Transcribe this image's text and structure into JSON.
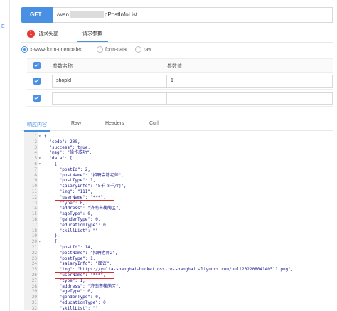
{
  "left_edge": {
    "tick": "E"
  },
  "request": {
    "method": "GET",
    "url_prefix": "/wan",
    "url_suffix": "pPostInfoList"
  },
  "req_tabs": {
    "badge": "1",
    "headers_label": "请求头部",
    "params_label": "请求参数"
  },
  "body_types": [
    {
      "label": "x-www-form-urlencoded",
      "selected": true
    },
    {
      "label": "form-data",
      "selected": false
    },
    {
      "label": "raw",
      "selected": false
    }
  ],
  "params_table": {
    "col_name": "参数名称",
    "col_value": "参数值",
    "rows": [
      {
        "name": "shopId",
        "value": "1"
      },
      {
        "name": "",
        "value": ""
      }
    ]
  },
  "response_tabs": [
    "响应内容",
    "Raw",
    "Headers",
    "Curl"
  ],
  "code_lines": [
    {
      "n": "1",
      "fold": "▾",
      "text": "{"
    },
    {
      "n": "2",
      "fold": "",
      "text": "  \"code\": 200,"
    },
    {
      "n": "3",
      "fold": "",
      "text": "  \"success\": true,"
    },
    {
      "n": "4",
      "fold": "",
      "text": "  \"msg\": \"操作成功\","
    },
    {
      "n": "5",
      "fold": "▾",
      "text": "  \"data\": ["
    },
    {
      "n": "6",
      "fold": "▾",
      "text": "    {"
    },
    {
      "n": "7",
      "fold": "",
      "text": "      \"postId\": 2,"
    },
    {
      "n": "8",
      "fold": "",
      "text": "      \"postName\": \"招聘会籍老师\","
    },
    {
      "n": "9",
      "fold": "",
      "text": "      \"postType\": 1,"
    },
    {
      "n": "10",
      "fold": "",
      "text": "      \"salaryInfo\": \"5千-8千/月\","
    },
    {
      "n": "11",
      "fold": "",
      "text": "      \"img\": \"111\","
    },
    {
      "n": "12",
      "fold": "",
      "text": "      \"userName\": \"***\","
    },
    {
      "n": "13",
      "fold": "",
      "text": "      \"type\": 0,"
    },
    {
      "n": "14",
      "fold": "",
      "text": "      \"address\": \"济南市槐荫区\","
    },
    {
      "n": "15",
      "fold": "",
      "text": "      \"ageType\": 0,"
    },
    {
      "n": "16",
      "fold": "",
      "text": "      \"genderType\": 0,"
    },
    {
      "n": "17",
      "fold": "",
      "text": "      \"educationType\": 0,"
    },
    {
      "n": "18",
      "fold": "",
      "text": "      \"skillList\": \"\""
    },
    {
      "n": "19",
      "fold": "",
      "text": "    },"
    },
    {
      "n": "20",
      "fold": "▾",
      "text": "    {"
    },
    {
      "n": "21",
      "fold": "",
      "text": "      \"postId\": 14,"
    },
    {
      "n": "22",
      "fold": "",
      "text": "      \"postName\": \"招聘老师2\","
    },
    {
      "n": "23",
      "fold": "",
      "text": "      \"postType\": 1,"
    },
    {
      "n": "24",
      "fold": "",
      "text": "      \"salaryInfo\": \"面议\","
    },
    {
      "n": "25",
      "fold": "",
      "text": "      \"img\": \"https://yulia-shanghai-bucket.oss-cn-shanghai.aliyuncs.com/null20220804140511.png\","
    },
    {
      "n": "26",
      "fold": "",
      "text": "      \"userName\": \"***\","
    },
    {
      "n": "27",
      "fold": "",
      "text": "      \"type\": 1,"
    },
    {
      "n": "28",
      "fold": "",
      "text": "      \"address\": \"济南市槐荫区\","
    },
    {
      "n": "29",
      "fold": "",
      "text": "      \"ageType\": 0,"
    },
    {
      "n": "30",
      "fold": "",
      "text": "      \"genderType\": 0,"
    },
    {
      "n": "31",
      "fold": "",
      "text": "      \"educationType\": 0,"
    },
    {
      "n": "32",
      "fold": "",
      "text": "      \"skillList\": \"\""
    }
  ],
  "colors": {
    "accent": "#4a90e2",
    "badge": "#e53935",
    "highlight": "#d32f2f",
    "code_text": "#1a1a8c"
  }
}
